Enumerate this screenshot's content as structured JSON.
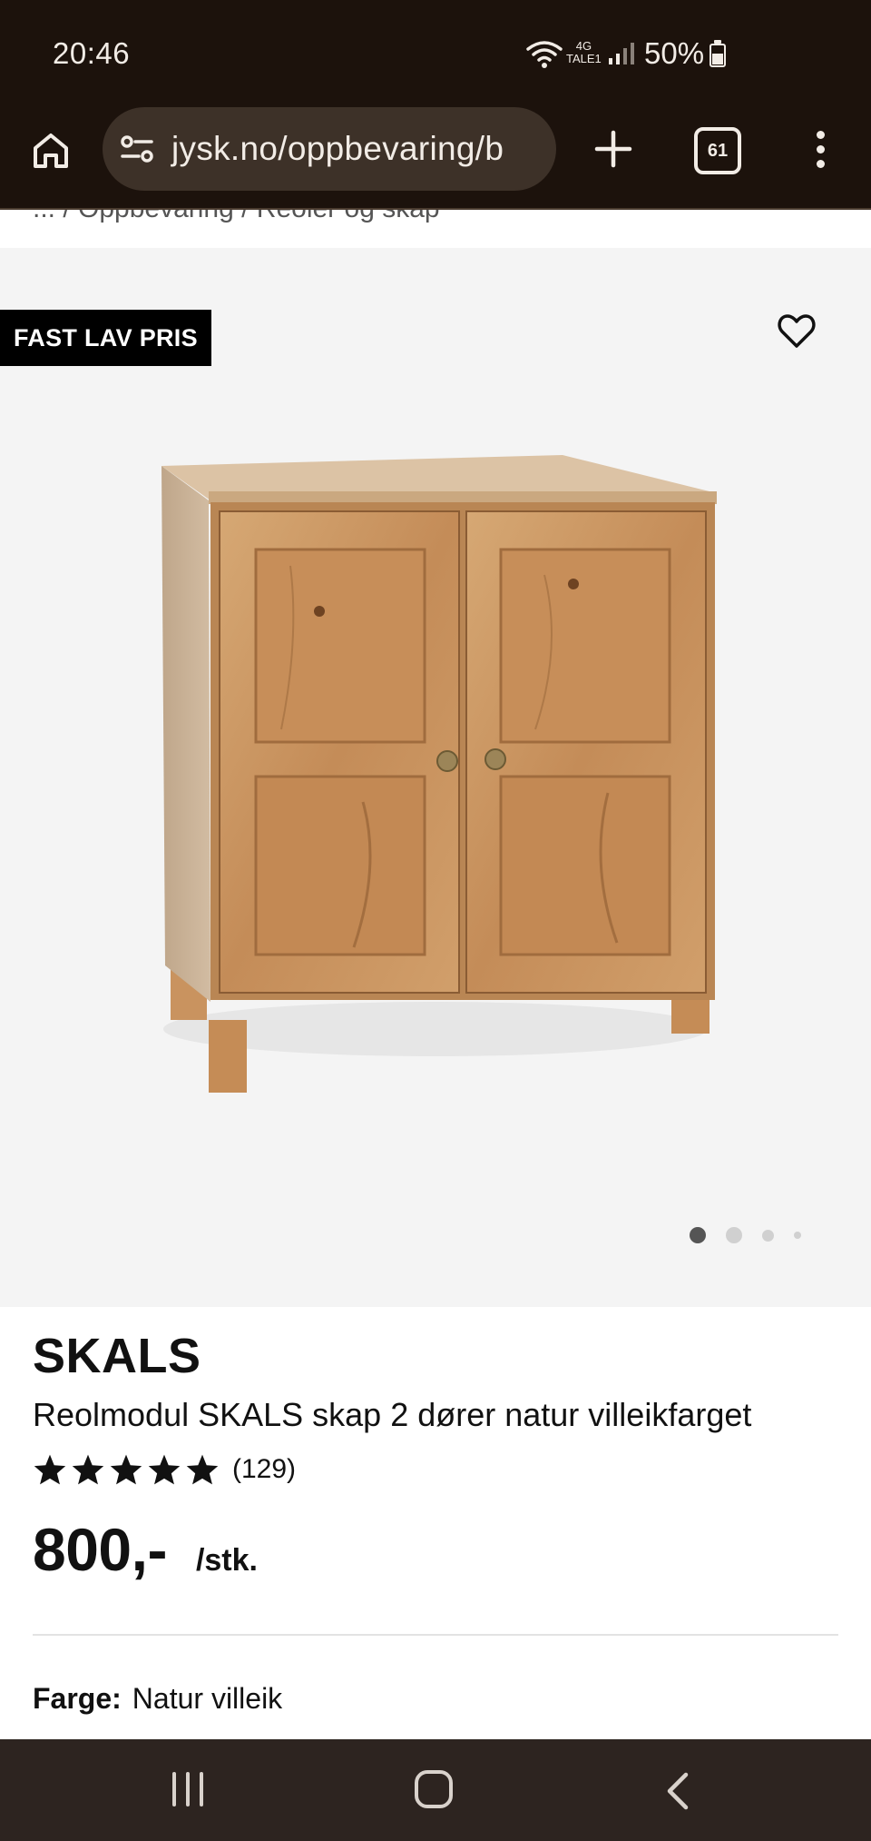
{
  "status_bar": {
    "time": "20:46",
    "network_top": "4G",
    "network_bottom": "TALE1",
    "battery": "50%"
  },
  "browser": {
    "url": "jysk.no/oppbevaring/b",
    "tab_count": "61"
  },
  "breadcrumb": "... / Oppbevaring / Reoler og skap",
  "gallery": {
    "badge": "FAST LAV PRIS",
    "image_count": 4,
    "active_image_index": 0
  },
  "product": {
    "brand": "SKALS",
    "name": "Reolmodul SKALS skap 2 dører natur villeikfarget",
    "rating": 5,
    "review_count": "(129)",
    "price": "800,-",
    "unit": "/stk.",
    "color_label": "Farge:",
    "color_value": "Natur villeik"
  },
  "colors": {
    "chrome": "#1c120c",
    "url_bar": "#3d3128",
    "gallery_bg": "#f4f4f4",
    "wood": "#c8915e"
  }
}
